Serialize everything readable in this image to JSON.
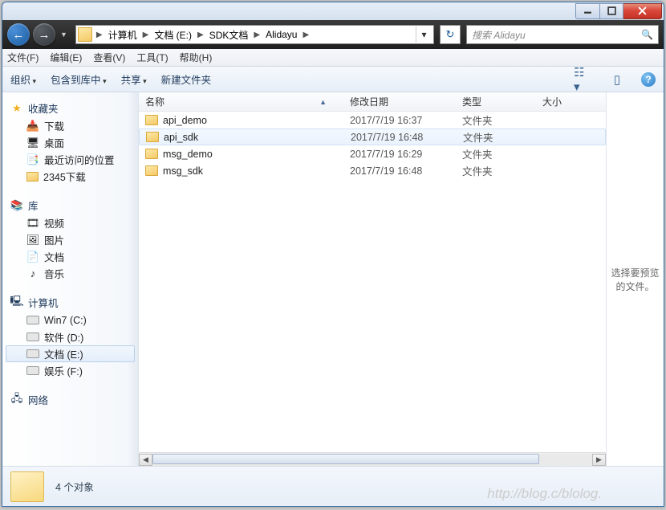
{
  "window_controls": {
    "min": "—",
    "max": "□",
    "close": "✕"
  },
  "breadcrumbs": {
    "root": "计算机",
    "drive": "文档 (E:)",
    "dir1": "SDK文档",
    "dir2": "Alidayu"
  },
  "search_placeholder": "搜索 Alidayu",
  "menu": {
    "file": "文件(F)",
    "edit": "编辑(E)",
    "view": "查看(V)",
    "tools": "工具(T)",
    "help": "帮助(H)"
  },
  "toolbar": {
    "organize": "组织",
    "include": "包含到库中",
    "share": "共享",
    "newfolder": "新建文件夹"
  },
  "sidebar": {
    "favorites": {
      "label": "收藏夹",
      "items": [
        {
          "icon": "download",
          "label": "下载"
        },
        {
          "icon": "desktop",
          "label": "桌面"
        },
        {
          "icon": "recent",
          "label": "最近访问的位置"
        },
        {
          "icon": "folder",
          "label": "2345下载"
        }
      ]
    },
    "library": {
      "label": "库",
      "items": [
        {
          "icon": "video",
          "label": "视频"
        },
        {
          "icon": "picture",
          "label": "图片"
        },
        {
          "icon": "document",
          "label": "文档"
        },
        {
          "icon": "music",
          "label": "音乐"
        }
      ]
    },
    "computer": {
      "label": "计算机",
      "items": [
        {
          "icon": "osdrive",
          "label": "Win7 (C:)"
        },
        {
          "icon": "drive",
          "label": "软件 (D:)"
        },
        {
          "icon": "drive",
          "label": "文档 (E:)",
          "selected": true
        },
        {
          "icon": "drive",
          "label": "娱乐 (F:)"
        }
      ]
    },
    "network": {
      "label": "网络"
    }
  },
  "columns": {
    "name": "名称",
    "date": "修改日期",
    "type": "类型",
    "size": "大小"
  },
  "files": [
    {
      "name": "api_demo",
      "date": "2017/7/19 16:37",
      "type": "文件夹",
      "size": ""
    },
    {
      "name": "api_sdk",
      "date": "2017/7/19 16:48",
      "type": "文件夹",
      "size": "",
      "highlight": true
    },
    {
      "name": "msg_demo",
      "date": "2017/7/19 16:29",
      "type": "文件夹",
      "size": ""
    },
    {
      "name": "msg_sdk",
      "date": "2017/7/19 16:48",
      "type": "文件夹",
      "size": ""
    }
  ],
  "preview_text": "选择要预览的文件。",
  "status_text": "4 个对象",
  "watermark": "http://blog.c/blolog."
}
